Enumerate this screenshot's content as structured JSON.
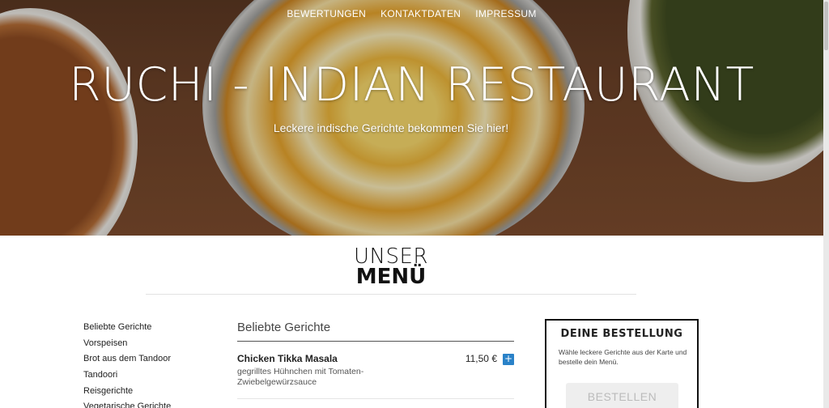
{
  "nav": {
    "items": [
      "BEWERTUNGEN",
      "KONTAKTDATEN",
      "IMPRESSUM"
    ]
  },
  "hero": {
    "title": "RUCHI - INDIAN RESTAURANT",
    "subtitle": "Leckere indische Gerichte bekommen Sie hier!"
  },
  "menu_heading": {
    "line1": "UNSER",
    "line2": "MENÜ"
  },
  "categories": [
    "Beliebte Gerichte",
    "Vorspeisen",
    "Brot aus dem Tandoor",
    "Tandoori",
    "Reisgerichte",
    "Vegetarische Gerichte"
  ],
  "section": {
    "title": "Beliebte Gerichte"
  },
  "dishes": [
    {
      "name": "Chicken Tikka Masala",
      "description": "gegrilltes Hühnchen mit Tomaten-Zwiebelgewürzsauce",
      "price": "11,50 €",
      "add_label": "+"
    }
  ],
  "order": {
    "title": "DEINE BESTELLUNG",
    "text": "Wähle leckere Gerichte aus der Karte und bestelle dein Menü.",
    "button_label": "BESTELLEN"
  }
}
